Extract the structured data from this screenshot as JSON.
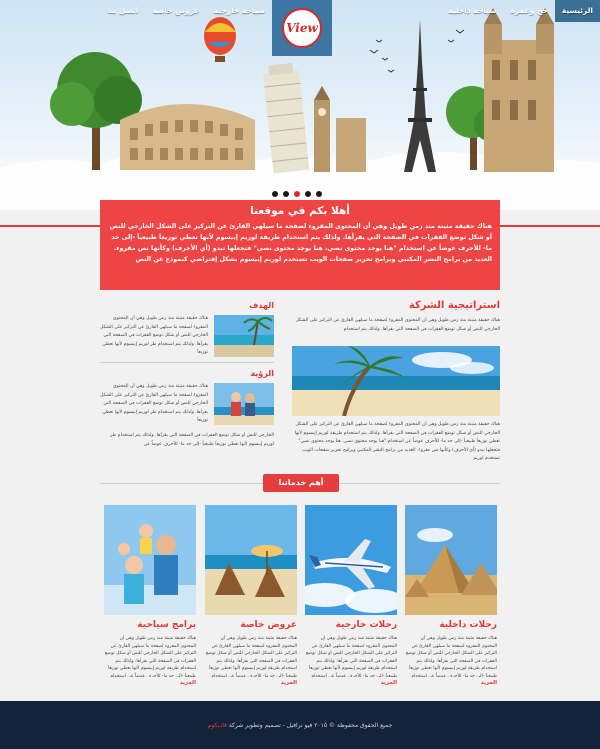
{
  "nav": {
    "home": "الرئيسية",
    "hajj": "حج وعمرة",
    "domestic": "سياحة داخلية",
    "foreign": "سياحة خارجية",
    "offers": "عروض خاصة",
    "contact": "اتصل بنا"
  },
  "logo": {
    "text": "View"
  },
  "colors": {
    "accent": "#e03a3a",
    "nav_active": "#3a6f96",
    "footer_bg": "#14223a",
    "welcome_bg": "#ef4444"
  },
  "welcome": {
    "title": "أهلا بكم في موقعنا",
    "text": "هناك حقيقة مثبتة منذ زمن طويل وهي أن المحتوى المقروء لصفحة ما سيلهي القارئ عن التركيز على الشكل الخارجي للنص أو شكل توضع الفقرات في الصفحة التي يقرأها. ولذلك يتم استخدام طريقة لوريم إيبسوم لأنها تعطي توزيعاَ طبيعياَ -إلى حد ما- للأحرف عوضاً عن استخدام \"هنا يوجد محتوى نصي، هنا يوجد محتوى نصي\" فتجعلها تبدو (أي الأحرف) وكأنها نص مقروء. العديد من برامح النشر المكتبي وبرامح تحرير صفحات الويب تستخدم لوريم إيبسوم بشكل إفتراضي كنموذج عن النص"
  },
  "strategy": {
    "title": "استراتيجية الشركة",
    "text_top": "هناك حقيقة مثبتة منذ زمن طويل وهي أن المحتوى المقروء لصفحة ما سيلهي القارئ عن التركيز على الشكل الخارجي للنص أو شكل توضع الفقرات في الصفحة التي يقرأها. ولذلك يتم استخدام",
    "text_bottom": "هناك حقيقة مثبتة منذ زمن طويل وهي أن المحتوى المقروء لصفحة ما سيلهي القارئ عن التركيز على الشكل الخارجي للنص أو شكل توضع الفقرات في الصفحة التي يقرأها. ولذلك يتم استخدام طريقة لوريم إيبسوم لأنها تعطي توزيعاَ طبيعياَ -إلى حد ما- للأحرف عوضاً عن استخدام \"هنا يوجد محتوى نصي، هنا يوجد محتوى نصي\" فتجعلها تبدو (أي الأحرف) وكأنها نص مقروء. العديد من برامح النشر المكتبي وبرامح تحرير صفحات الويب تستخدم لوريم"
  },
  "goal": {
    "title": "الهدف",
    "text": "هناك حقيقة مثبتة منذ زمن طويل وهي أن المحتوى المقروء لصفحة ما سيلهي القارئ عن التركيز على الشكل الخارجي للنص أو شكل توضع الفقرات في الصفحة التي يقرأها. ولذلك يتم استخدام طر لوريم إيبسوم لأنها تعطي توزيعاَ"
  },
  "vision": {
    "title": "الرؤية",
    "text": "هناك حقيقة مثبتة منذ زمن طويل وهي أن المحتوى المقروء لصفحة ما سيلهي القارئ عن التركيز على الشكل الخارجي للنص أو شكل توضع الفقرات في الصفحة التي يقرأها. ولذلك يتم استخدام طر لوريم إيبسوم لأنها تعطي توزيعاَ",
    "text_extra": "الخارجي للنص أو شكل توضع الفقرات في الصفحة التي يقرأها. ولذلك يتم استخدام طر لوريم إيبسوم لأنها تعطي توزيعاَ طبيعياَ -إلى حد ما- للأحرف عوضاً عن"
  },
  "services": {
    "heading": "أهم خدماتنا",
    "items": [
      {
        "title": "رحلات داخلية",
        "more": "المزيد",
        "text": "هناك حقيقة مثبتة منذ زمن طويل وهي أن المحتوى المقروء لصفحة ما سيلهي القارئ عن التركيز على الشكل الخارجي للنص أو شكل توضع الفقرات في الصفحة التي يقرأها. ولذلك يتم استخدام طريقة لوريم إيبسوم لأنها تعطي توزيعاَ طبيعياَ -إلى حد ما- للأحرف عوضاً عن استخدام \"هنا يوجد محتوى نصي، هنا يوجد محتوى نصي\""
      },
      {
        "title": "رحلات خارجية",
        "more": "المزيد",
        "text": "هناك حقيقة مثبتة منذ زمن طويل وهي أن المحتوى المقروء لصفحة ما سيلهي القارئ عن التركيز على الشكل الخارجي للنص أو شكل توضع الفقرات في الصفحة التي يقرأها. ولذلك يتم استخدام طريقة لوريم إيبسوم لأنها تعطي توزيعاَ طبيعياَ -إلى حد ما- للأحرف عوضاً عن استخدام \"هنا يوجد محتوى نصي، هنا يوجد محتوى نصي\""
      },
      {
        "title": "عروض خاصة",
        "more": "المزيد",
        "text": "هناك حقيقة مثبتة منذ زمن طويل وهي أن المحتوى المقروء لصفحة ما سيلهي القارئ عن التركيز على الشكل الخارجي للنص أو شكل توضع الفقرات في الصفحة التي يقرأها. ولذلك يتم استخدام طريقة لوريم إيبسوم لأنها تعطي توزيعاَ طبيعياَ -إلى حد ما- للأحرف عوضاً عن استخدام \"هنا يوجد محتوى نصي، هنا يوجد محتوى نصي\""
      },
      {
        "title": "برامج سياحية",
        "more": "المزيد",
        "text": "هناك حقيقة مثبتة منذ زمن طويل وهي أن المحتوى المقروء لصفحة ما سيلهي القارئ عن التركيز على الشكل الخارجي للنص أو شكل توضع الفقرات في الصفحة التي يقرأها. ولذلك يتم استخدام طريقة لوريم إيبسوم لأنها تعطي توزيعاَ طبيعياَ -إلى حد ما- للأحرف عوضاً عن استخدام \"هنا يوجد محتوى نصي، هنا يوجد محتوى نصي\""
      }
    ]
  },
  "footer": {
    "copyright": "جميع الحقوق محفوظة © ٢٠١٥ فيو ترافيل - تصميم وتطوير شركة",
    "brand": "فاديكوم"
  }
}
